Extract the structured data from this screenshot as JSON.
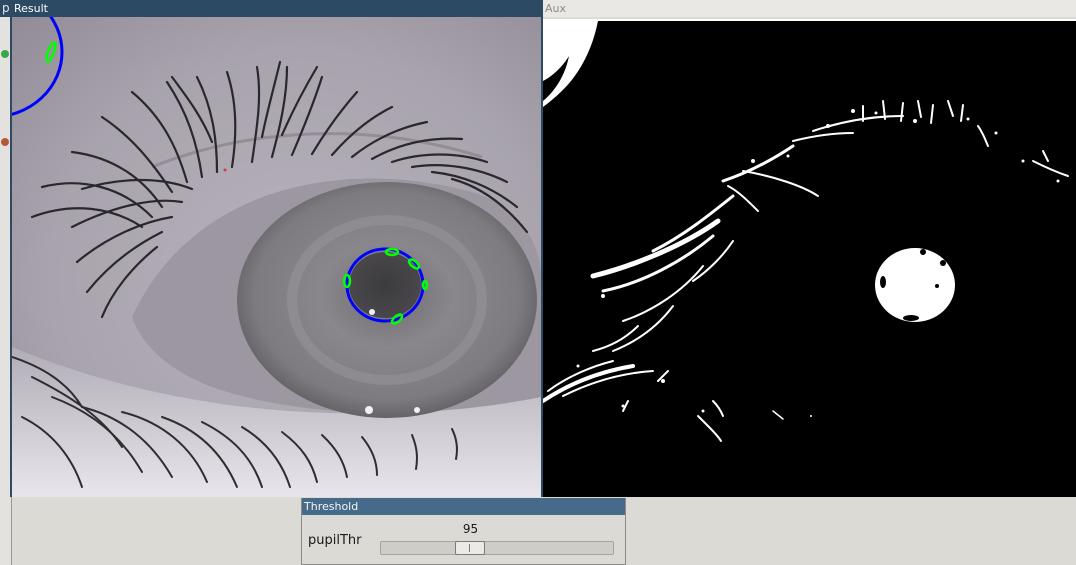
{
  "background_window": {
    "title": "p"
  },
  "windows": {
    "result": {
      "title": "Result",
      "image": "eye-closeup-with-pupil-fit"
    },
    "aux": {
      "title": "Aux",
      "image": "binary-threshold-mask"
    },
    "threshold": {
      "title": "Threshold",
      "slider": {
        "label": "pupilThr",
        "value": "95",
        "fraction": 0.37
      }
    }
  },
  "colors": {
    "active_titlebar": "#2c4a63",
    "panel_bg": "#dcdad5",
    "fit_ellipse": "#0000ff",
    "fit_points": "#00ff00"
  }
}
